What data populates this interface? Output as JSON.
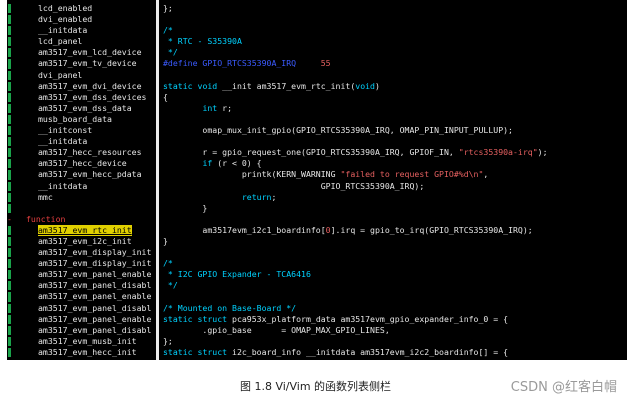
{
  "taglist": [
    {
      "text": "lcd_enabled"
    },
    {
      "text": "dvi_enabled"
    },
    {
      "text": "__initdata"
    },
    {
      "text": "lcd_panel"
    },
    {
      "text": "am3517_evm_lcd_device"
    },
    {
      "text": "am3517_evm_tv_device"
    },
    {
      "text": "dvi_panel"
    },
    {
      "text": "am3517_evm_dvi_device"
    },
    {
      "text": "am3517_evm_dss_devices"
    },
    {
      "text": "am3517_evm_dss_data"
    },
    {
      "text": "musb_board_data"
    },
    {
      "text": "__initconst"
    },
    {
      "text": "__initdata"
    },
    {
      "text": "am3517_hecc_resources"
    },
    {
      "text": "am3517_hecc_device"
    },
    {
      "text": "am3517_evm_hecc_pdata"
    },
    {
      "text": "__initdata"
    },
    {
      "text": "mmc"
    },
    {
      "text": ""
    },
    {
      "fold": "-",
      "kind": "function"
    },
    {
      "text": "am3517_evm_rtc_init",
      "highlight": true
    },
    {
      "text": "am3517_evm_i2c_init"
    },
    {
      "text": "am3517_evm_display_init"
    },
    {
      "text": "am3517_evm_display_init"
    },
    {
      "text": "am3517_evm_panel_enable"
    },
    {
      "text": "am3517_evm_panel_disabl"
    },
    {
      "text": "am3517_evm_panel_enable"
    },
    {
      "text": "am3517_evm_panel_disabl"
    },
    {
      "text": "am3517_evm_panel_enable"
    },
    {
      "text": "am3517_evm_panel_disabl"
    },
    {
      "text": "am3517_evm_musb_init"
    },
    {
      "text": "am3517_evm_hecc_init"
    }
  ],
  "code": [
    "};",
    "",
    "/*",
    " * RTC - S35390A",
    " */",
    "#define GPIO_RTCS35390A_IRQ     55",
    "",
    "static void __init am3517_evm_rtc_init(void)",
    "{",
    "        int r;",
    "",
    "        omap_mux_init_gpio(GPIO_RTCS35390A_IRQ, OMAP_PIN_INPUT_PULLUP);",
    "",
    "        r = gpio_request_one(GPIO_RTCS35390A_IRQ, GPIOF_IN, \"rtcs35390a-irq\");",
    "        if (r < 0) {",
    "                printk(KERN_WARNING \"failed to request GPIO#%d\\n\",",
    "                                GPIO_RTCS35390A_IRQ);",
    "                return;",
    "        }",
    "",
    "        am3517evm_i2c1_boardinfo[0].irq = gpio_to_irq(GPIO_RTCS35390A_IRQ);",
    "}",
    "",
    "/*",
    " * I2C GPIO Expander - TCA6416",
    " */",
    "",
    "/* Mounted on Base-Board */",
    "static struct pca953x_platform_data am3517evm_gpio_expander_info_0 = {",
    "        .gpio_base      = OMAP_MAX_GPIO_LINES,",
    "};",
    "static struct i2c_board_info __initdata am3517evm_i2c2_boardinfo[] = {"
  ],
  "colors": {
    "background": "#000000",
    "comment": "#00d2ff",
    "string": "#e66060",
    "highlight": "#e0d000",
    "gutter": "#1aa34a"
  },
  "caption": "图 1.8 Vi/Vim 的函数列表侧栏",
  "watermark": "CSDN @红客白帽"
}
